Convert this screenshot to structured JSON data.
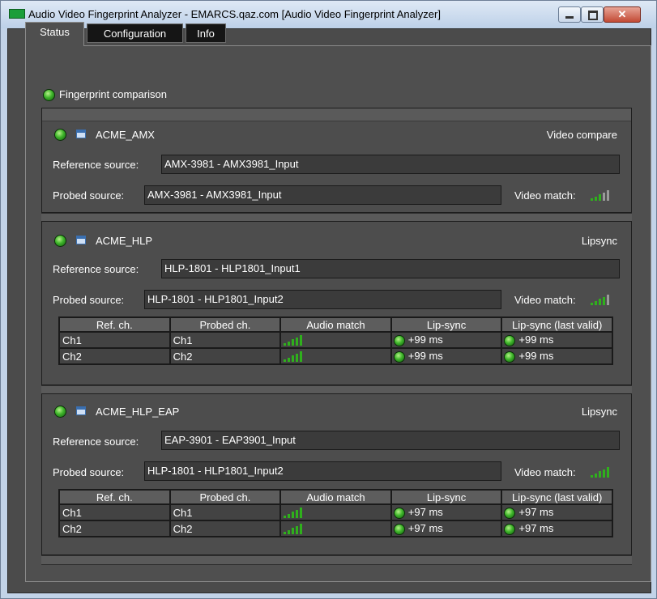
{
  "window": {
    "title": "Audio Video Fingerprint Analyzer - EMARCS.qaz.com [Audio Video Fingerprint Analyzer]"
  },
  "tabs": [
    "Status",
    "Configuration",
    "Info"
  ],
  "section": {
    "title": "Fingerprint comparison"
  },
  "labels": {
    "reference": "Reference source:",
    "probed": "Probed source:",
    "video_match": "Video match:"
  },
  "table_headers": [
    "Ref. ch.",
    "Probed ch.",
    "Audio match",
    "Lip-sync",
    "Lip-sync (last valid)"
  ],
  "colors": {
    "led_green": "#3eb52a",
    "signal_on": "#2fb01c",
    "signal_off": "#9a9a9a"
  },
  "groups": [
    {
      "name": "ACME_AMX",
      "mode": "Video compare",
      "reference_source": "AMX-3981 - AMX3981_Input",
      "probed_source": "AMX-3981 - AMX3981_Input",
      "video_match_level": 0.6
    },
    {
      "name": "ACME_HLP",
      "mode": "Lipsync",
      "reference_source": "HLP-1801 - HLP1801_Input1",
      "probed_source": "HLP-1801 - HLP1801_Input2",
      "video_match_level": 0.8,
      "rows": [
        {
          "ref": "Ch1",
          "probed": "Ch1",
          "lipsync": "+99 ms",
          "lipsync_last": "+99 ms"
        },
        {
          "ref": "Ch2",
          "probed": "Ch2",
          "lipsync": "+99 ms",
          "lipsync_last": "+99 ms"
        }
      ]
    },
    {
      "name": "ACME_HLP_EAP",
      "mode": "Lipsync",
      "reference_source": "EAP-3901 - EAP3901_Input",
      "probed_source": "HLP-1801 - HLP1801_Input2",
      "video_match_level": 1.0,
      "rows": [
        {
          "ref": "Ch1",
          "probed": "Ch1",
          "lipsync": "+97 ms",
          "lipsync_last": "+97 ms"
        },
        {
          "ref": "Ch2",
          "probed": "Ch2",
          "lipsync": "+97 ms",
          "lipsync_last": "+97 ms"
        }
      ]
    }
  ]
}
